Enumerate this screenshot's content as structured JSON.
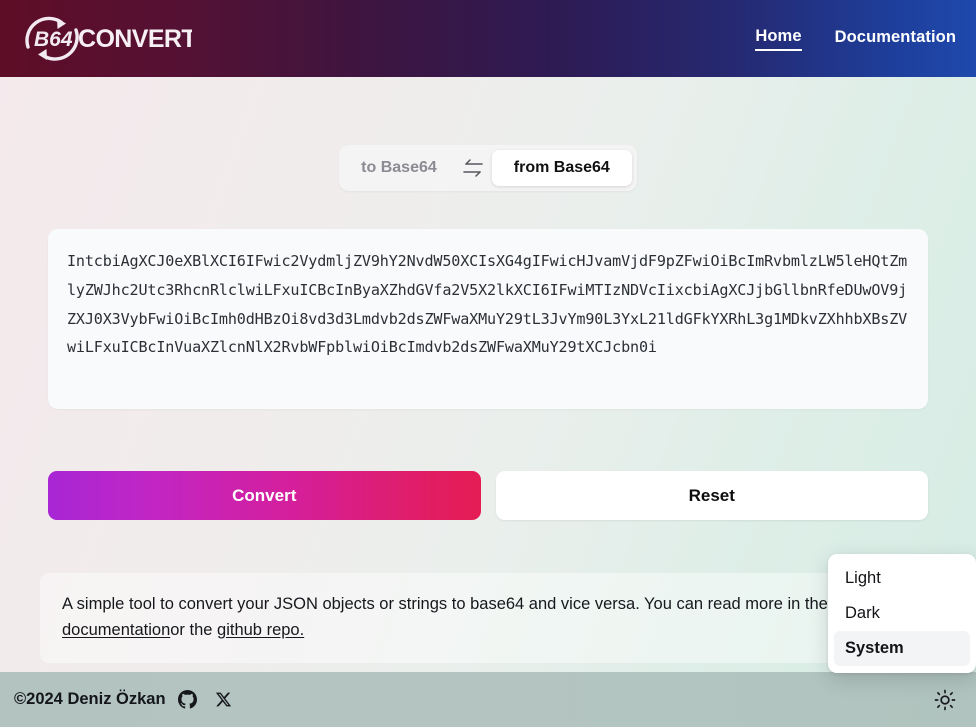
{
  "header": {
    "logo_text": "B64",
    "logo_word": "CONVERTER",
    "nav": [
      {
        "label": "Home",
        "active": true
      },
      {
        "label": "Documentation",
        "active": false
      }
    ]
  },
  "mode_switch": {
    "to_base64_label": "to Base64",
    "from_base64_label": "from Base64",
    "swap_icon": "swap-arrows-icon",
    "active": "from Base64"
  },
  "editor": {
    "value": "IntcbiAgXCJ0eXBlXCI6IFwic2VydmljZV9hY2NvdW50XCIsXG4gIFwicHJvamVjdF9pZFwiOiBcImRvbmlzLW5leHQtZmlyZWJhc2Utc3RhcnRlclwiLFxuICBcInByaXZhdGVfa2V5X2lkXCI6IFwiMTIzNDVcIixcbiAgXCJjbGllbnRfeDUwOV9jZXJ0X3VybFwiOiBcImh0dHBzOi8vd3d3Lmdvb2dsZWFwaXMuY29tL3JvYm90L3YxL21ldGFkYXRhL3g1MDkvZXhhbXBsZVwiLFxuICBcInVuaXZlcnNlX2RvbWFpblwiOiBcImdvb2dsZWFwaXMuY29tXCJcbn0i"
  },
  "actions": {
    "convert_label": "Convert",
    "reset_label": "Reset"
  },
  "info": {
    "text_before": "A simple tool to convert your JSON objects or strings to base64 and vice versa. You can read more in the ",
    "link_documentation": "documentation",
    "text_middle": "or the ",
    "link_github": "github repo.",
    "text_after": ""
  },
  "theme_menu": {
    "items": [
      {
        "label": "Light",
        "selected": false
      },
      {
        "label": "Dark",
        "selected": false
      },
      {
        "label": "System",
        "selected": true
      }
    ]
  },
  "footer": {
    "copyright": "©2024 Deniz Özkan",
    "github_icon": "github-icon",
    "x_icon": "x-twitter-icon",
    "theme_toggle_icon": "sun-icon"
  },
  "colors": {
    "accent_start": "#a726d4",
    "accent_end": "#e51c54",
    "header_start": "#5e0d26",
    "header_end": "#1f49ad",
    "footer_bg": "#b3c3bf"
  }
}
